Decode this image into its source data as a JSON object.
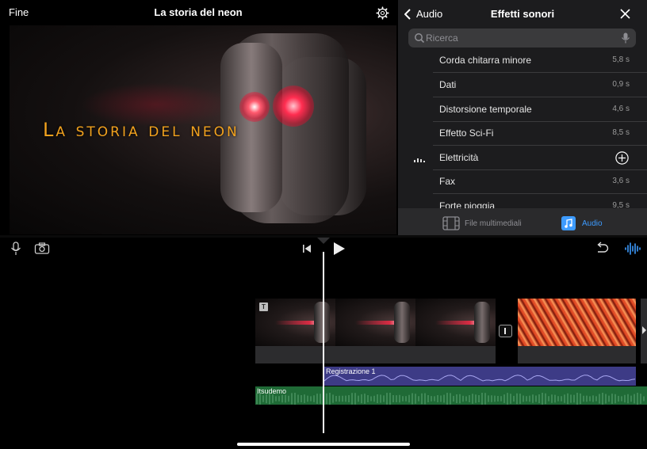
{
  "viewer": {
    "done_label": "Fine",
    "project_title": "La storia del neon",
    "title_overlay": "La storia del neon"
  },
  "browser": {
    "back_label": "Audio",
    "title": "Effetti sonori",
    "search_placeholder": "Ricerca",
    "items": [
      {
        "name": "Corda chitarra minore",
        "duration": "5,8 s"
      },
      {
        "name": "Dati",
        "duration": "0,9 s"
      },
      {
        "name": "Distorsione temporale",
        "duration": "4,6 s"
      },
      {
        "name": "Effetto Sci-Fi",
        "duration": "8,5 s"
      },
      {
        "name": "Elettricità",
        "duration": ""
      },
      {
        "name": "Fax",
        "duration": "3,6 s"
      },
      {
        "name": "Forte pioggia",
        "duration": "9,5 s"
      }
    ],
    "tabs": [
      {
        "label": "File multimediali",
        "icon": "film-icon",
        "selected": false
      },
      {
        "label": "Audio",
        "icon": "music-note-icon",
        "selected": true
      }
    ]
  },
  "timeline": {
    "recording_label": "Registrazione 1",
    "music_label": "Itsudemo"
  },
  "colors": {
    "accent": "#3d9bff",
    "title_text": "#f2a21e",
    "recording_track": "#3d3b86",
    "music_track": "#1f6a36"
  }
}
